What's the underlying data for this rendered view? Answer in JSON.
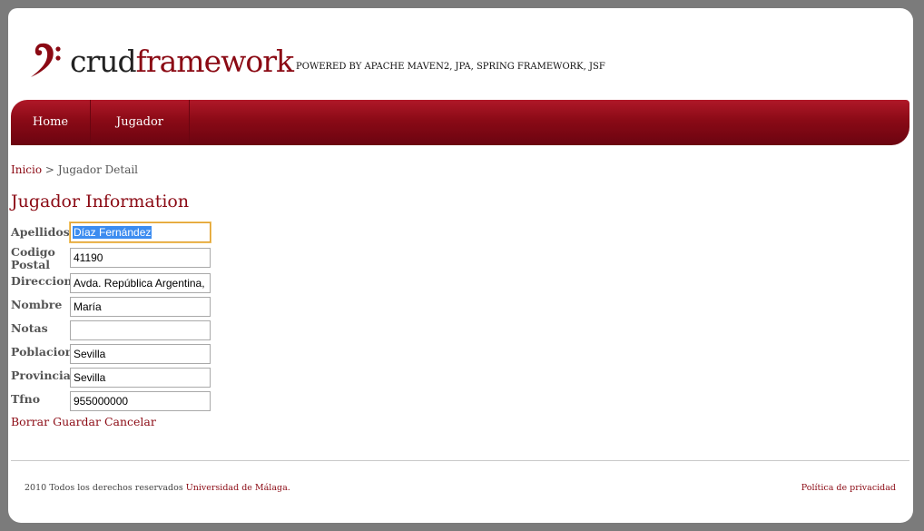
{
  "header": {
    "logo_part1": "crud",
    "logo_part2": "framework",
    "tagline": "POWERED BY APACHE MAVEN2, JPA, SPRING FRAMEWORK, JSF"
  },
  "nav": {
    "items": [
      {
        "label": "Home"
      },
      {
        "label": "Jugador"
      }
    ]
  },
  "breadcrumb": {
    "home": "Inicio",
    "separator": ">",
    "current": "Jugador Detail"
  },
  "page_title": "Jugador Information",
  "form": {
    "fields": [
      {
        "label": "Apellidos",
        "value": "Díaz Fernández",
        "focused": true
      },
      {
        "label": "Codigo Postal",
        "value": "41190"
      },
      {
        "label": "Direccion",
        "value": "Avda. República Argentina,"
      },
      {
        "label": "Nombre",
        "value": "María"
      },
      {
        "label": "Notas",
        "value": ""
      },
      {
        "label": "Poblacion",
        "value": "Sevilla"
      },
      {
        "label": "Provincia",
        "value": "Sevilla"
      },
      {
        "label": "Tfno",
        "value": "955000000"
      }
    ]
  },
  "actions": {
    "delete": "Borrar",
    "save": "Guardar",
    "cancel": "Cancelar"
  },
  "footer": {
    "copyright": "2010 Todos los derechos reservados",
    "org": "Universidad de Málaga.",
    "privacy": "Política de privacidad"
  },
  "colors": {
    "brand": "#8b0a14",
    "nav_bg": "#8a0a16"
  }
}
